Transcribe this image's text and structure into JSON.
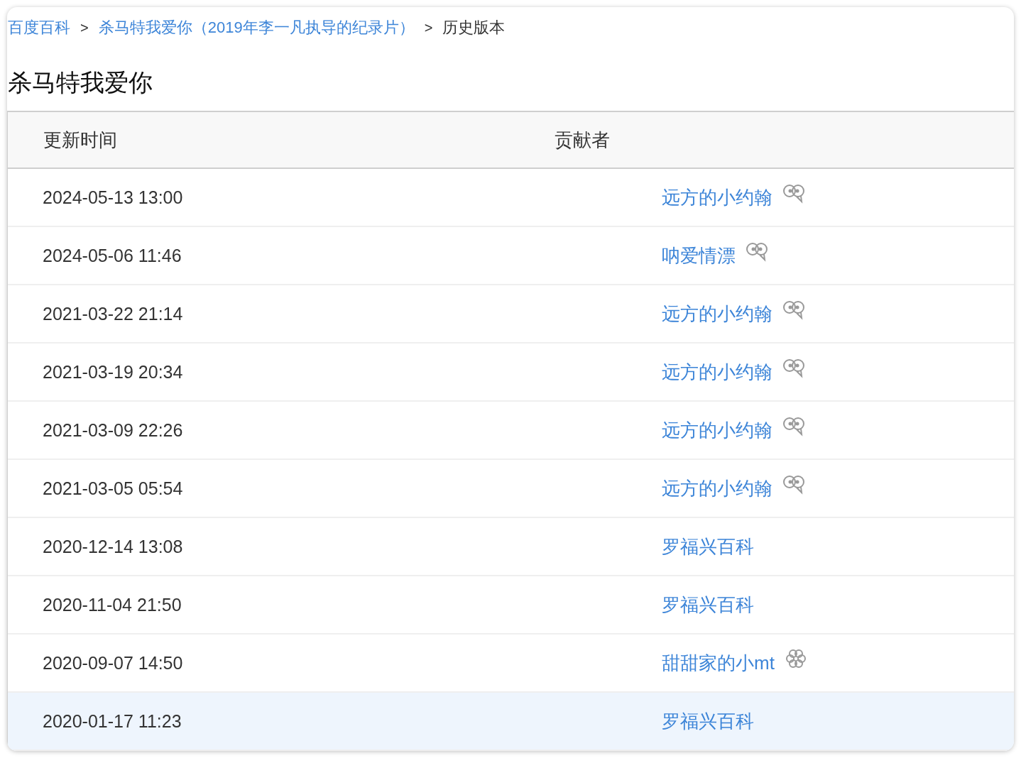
{
  "breadcrumb": [
    {
      "label": "百度百科",
      "kind": "link"
    },
    {
      "label": "杀马特我爱你（2019年李一凡执导的纪录片）",
      "kind": "link"
    },
    {
      "label": "历史版本",
      "kind": "current"
    }
  ],
  "breadcrumb_separator": ">",
  "title": "杀马特我爱你",
  "table": {
    "columns": [
      "更新时间",
      "贡献者"
    ],
    "rows": [
      {
        "time": "2024-05-13 13:00",
        "contributor": "远方的小约翰",
        "kind": "eyes",
        "selected": false
      },
      {
        "time": "2024-05-06 11:46",
        "contributor": "呐爱情漂",
        "kind": "eyes",
        "selected": false
      },
      {
        "time": "2021-03-22 21:14",
        "contributor": "远方的小约翰",
        "kind": "eyes",
        "selected": false
      },
      {
        "time": "2021-03-19 20:34",
        "contributor": "远方的小约翰",
        "kind": "eyes",
        "selected": false
      },
      {
        "time": "2021-03-09 22:26",
        "contributor": "远方的小约翰",
        "kind": "eyes",
        "selected": false
      },
      {
        "time": "2021-03-05 05:54",
        "contributor": "远方的小约翰",
        "kind": "eyes",
        "selected": false
      },
      {
        "time": "2020-12-14 13:08",
        "contributor": "罗福兴百科",
        "kind": "plain",
        "selected": false
      },
      {
        "time": "2020-11-04 21:50",
        "contributor": "罗福兴百科",
        "kind": "plain",
        "selected": false
      },
      {
        "time": "2020-09-07 14:50",
        "contributor": "甜甜家的小mt",
        "kind": "flower",
        "selected": false
      },
      {
        "time": "2020-01-17 11:23",
        "contributor": "罗福兴百科",
        "kind": "plain",
        "selected": true
      }
    ]
  }
}
